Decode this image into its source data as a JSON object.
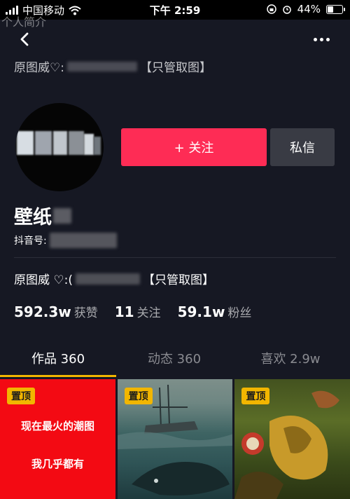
{
  "status_bar": {
    "carrier": "中国移动",
    "time": "下午 2:59",
    "battery": "44%",
    "battery_level": 0.44
  },
  "page_ghost_title": "个人简介",
  "nav": {
    "back_icon": "chevron-left-icon",
    "more_icon": "more-dots-icon"
  },
  "header_text": {
    "prefix": "原图威♡:",
    "suffix": "【只管取图】"
  },
  "profile": {
    "name": "壁纸",
    "douyin_id_label": "抖音号:",
    "bio_prefix": "原图威 ♡:(",
    "bio_suffix": "【只管取图】"
  },
  "actions": {
    "follow_label": "+ 关注",
    "message_label": "私信"
  },
  "stats": [
    {
      "value": "592.3w",
      "label": "获赞"
    },
    {
      "value": "11",
      "label": "关注"
    },
    {
      "value": "59.1w",
      "label": "粉丝"
    }
  ],
  "tabs": [
    {
      "label": "作品 360",
      "active": true
    },
    {
      "label": "动态 360",
      "active": false
    },
    {
      "label": "喜欢 2.9w",
      "active": false
    }
  ],
  "grid": [
    {
      "badge": "置顶",
      "lines": [
        "现在最火的潮图",
        "我几乎都有"
      ]
    },
    {
      "badge": "置顶"
    },
    {
      "badge": "置顶"
    }
  ],
  "colors": {
    "background": "#161823",
    "follow": "#fe2c55",
    "message": "#393b44",
    "accent": "#f2b600"
  }
}
